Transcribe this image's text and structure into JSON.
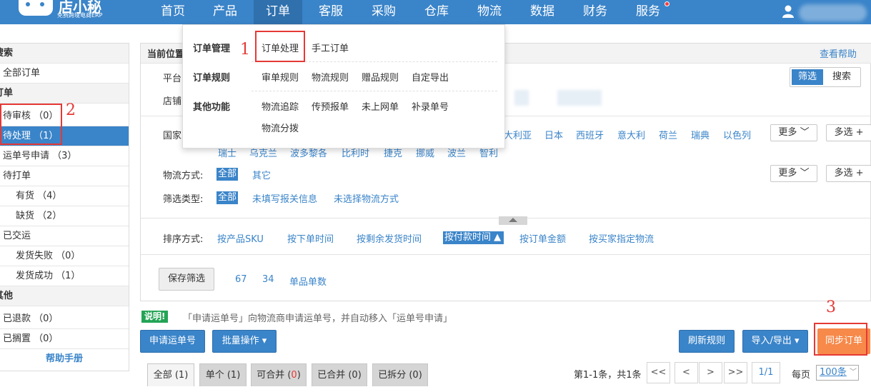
{
  "brand": {
    "name": "店小秘",
    "subtitle": "免费跨境电商ERP"
  },
  "nav": [
    "首页",
    "产品",
    "订单",
    "客服",
    "采购",
    "仓库",
    "物流",
    "数据",
    "财务",
    "服务"
  ],
  "nav_active": "订单",
  "sidebar": {
    "search_head": "搜索",
    "all_orders": "全部订单",
    "orders_head": "订单",
    "pending_review": "待审核 （0）",
    "pending_process": "待处理 （1）",
    "tracking_request": "运单号申请 （3）",
    "to_print": "待打单",
    "in_stock": "有货 （4）",
    "out_of_stock": "缺货 （2）",
    "shipped": "已交运",
    "ship_failed": "发货失败 （0）",
    "ship_success": "发货成功 （1）",
    "other_head": "其他",
    "refunded": "已退款 （0）",
    "on_hold": "已搁置 （0）",
    "help": "帮助手册"
  },
  "dropdown": {
    "order_mgmt": "订单管理",
    "order_process": "订单处理",
    "manual_order": "手工订单",
    "order_rules": "订单规则",
    "review_rules": "审单规则",
    "logistics_rules": "物流规则",
    "gift_rules": "赠品规则",
    "custom_export": "自定导出",
    "other_funcs": "其他功能",
    "tracking": "物流追踪",
    "pre_declare": "传预报单",
    "not_online": "未上网单",
    "supplement_no": "补录单号",
    "logistics_split": "物流分拨"
  },
  "main": {
    "breadcrumb": "当前位置",
    "help_link": "查看帮助",
    "platform_label": "平台",
    "store_label": "店铺",
    "filter_btn": "筛选",
    "search_btn": "搜索",
    "country_label": "国家",
    "countries_row1": [
      "大利亚",
      "日本",
      "西班牙",
      "意大利",
      "荷兰",
      "瑞典",
      "以色列"
    ],
    "countries_row2": [
      "瑞士",
      "乌克兰",
      "波多黎各",
      "比利时",
      "捷克",
      "挪威",
      "波兰",
      "智利"
    ],
    "more": "更多",
    "multi": "多选 +",
    "logistics_label": "物流方式:",
    "all": "全部",
    "other": "其它",
    "filter_type_label": "筛选类型:",
    "no_customs_info": "未填写报关信息",
    "no_logistics": "未选择物流方式",
    "sort_label": "排序方式:",
    "sort_sku": "按产品SKU",
    "sort_order_time": "按下单时间",
    "sort_remaining": "按剩余发货时间",
    "sort_pay_time": "按付款时间",
    "sort_amount": "按订单金额",
    "sort_buyer_logistics": "按买家指定物流",
    "save_filter": "保存筛选",
    "num1": "67",
    "num2": "34",
    "single_count": "单品单数"
  },
  "notice": {
    "badge": "说明!",
    "text": "「申请运单号」向物流商申请运单号，并自动移入「运单号申请」"
  },
  "actions": {
    "apply_tracking": "申请运单号",
    "batch": "批量操作 ▾",
    "refresh_rules": "刷新规则",
    "import_export": "导入/导出 ▾",
    "sync_orders": "同步订单"
  },
  "tabs": [
    {
      "label": "全部 (1)"
    },
    {
      "label": "单个 (1)"
    },
    {
      "label": "可合并 (0)"
    },
    {
      "label": "已合并 (0)"
    },
    {
      "label": "已拆分 (0)"
    }
  ],
  "pagination": {
    "summary": "第1-1条，共1条",
    "first": "<<",
    "prev": "<",
    "next": ">",
    "last": ">>",
    "page": "1/1",
    "per_page_label": "每页",
    "per_page": "100条"
  },
  "annotations": {
    "n1": "1",
    "n2": "2",
    "n3": "3"
  },
  "colors": {
    "primary": "#3a84c9",
    "annotation": "#e53935",
    "sync": "#f7894a",
    "notice": "#23a455"
  }
}
